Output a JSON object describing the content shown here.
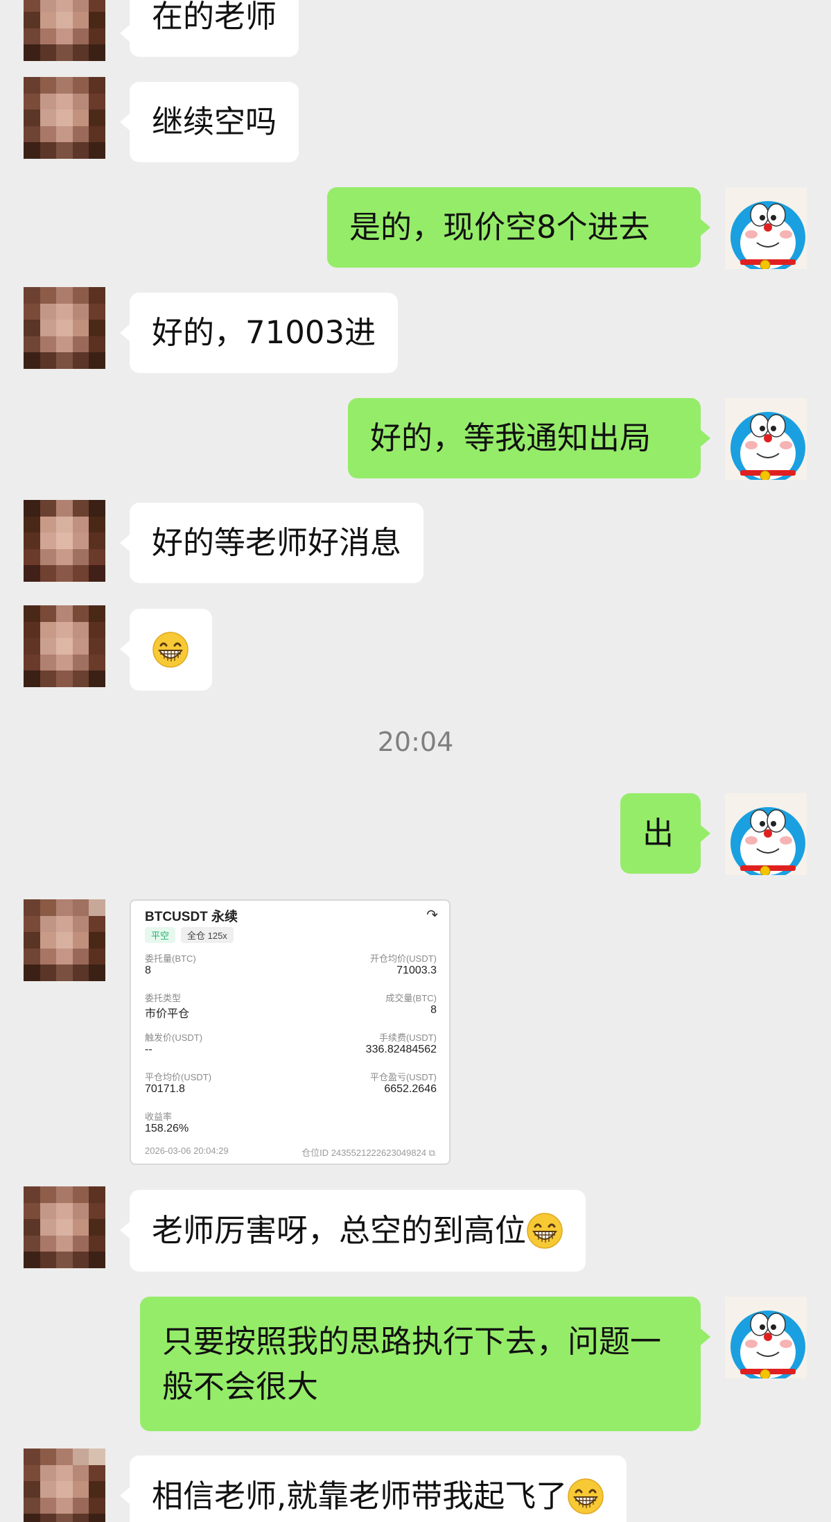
{
  "messages": {
    "m1": "在的老师",
    "m2": "继续空吗",
    "m3": "是的，现价空8个进去",
    "m4": "好的，71003进",
    "m5": "好的，等我通知出局",
    "m6": "好的等老师好消息",
    "m8": "出",
    "m9": "老师厉害呀，总空的到高位",
    "m10": "只要按照我的思路执行下去，问题一般不会很大",
    "m11": "相信老师,就靠老师带我起飞了"
  },
  "timestamp": "20:04",
  "trade_card": {
    "title": "BTCUSDT 永续",
    "side_tag": "平空",
    "mode_tag": "全仓 125x",
    "rows": [
      {
        "left_label": "委托量(BTC)",
        "left_value": "8",
        "right_label": "开仓均价(USDT)",
        "right_value": "71003.3"
      },
      {
        "left_label": "委托类型",
        "left_value": "市价平仓",
        "right_label": "成交量(BTC)",
        "right_value": "8"
      },
      {
        "left_label": "触发价(USDT)",
        "left_value": "--",
        "right_label": "手续费(USDT)",
        "right_value": "336.82484562"
      },
      {
        "left_label": "平仓均价(USDT)",
        "left_value": "70171.8",
        "right_label": "平仓盈亏(USDT)",
        "right_value": "6652.2646"
      },
      {
        "left_label": "收益率",
        "left_value": "158.26%",
        "right_label": "",
        "right_value": ""
      }
    ],
    "datetime": "2026-03-06 20:04:29",
    "position_id": "仓位ID 2435521222623049824"
  },
  "colors": {
    "background": "#ededed",
    "incoming_bubble": "#ffffff",
    "outgoing_bubble": "#95ec69",
    "timestamp_text": "#7f7f7f"
  },
  "icons": {
    "emoji": "grinning-face-with-smiling-eyes",
    "self_avatar": "doraemon-avatar",
    "contact_avatar": "pixelated-photo-avatar"
  }
}
